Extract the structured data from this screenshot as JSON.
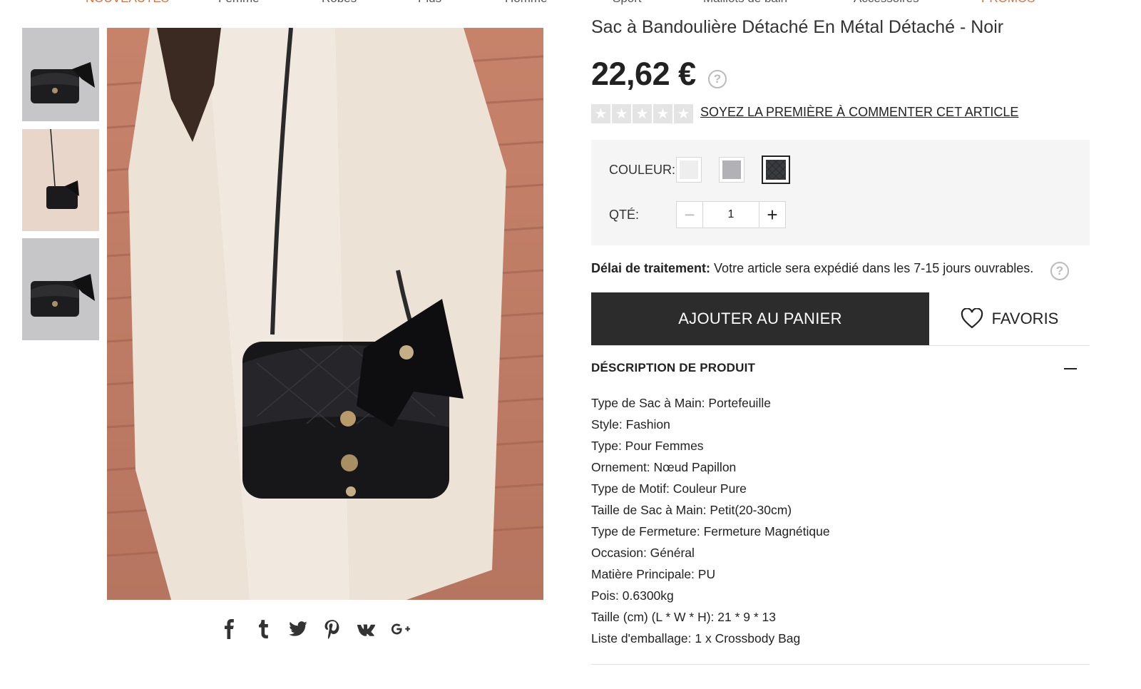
{
  "nav": {
    "items": [
      {
        "label": "NOUVEAUTÉS",
        "accent": true
      },
      {
        "label": "Femme",
        "accent": false
      },
      {
        "label": "Robes",
        "accent": false
      },
      {
        "label": "Plus",
        "accent": false
      },
      {
        "label": "Homme",
        "accent": false
      },
      {
        "label": "Sport",
        "accent": false
      },
      {
        "label": "Maillots de bain",
        "accent": false
      },
      {
        "label": "Accessoires",
        "accent": false
      },
      {
        "label": "PROMOS",
        "accent": true
      }
    ],
    "accent_color": "#d5703f"
  },
  "gallery": {
    "thumbnails": [
      "bag-product-photo",
      "model-wearing-bag-photo",
      "bag-product-photo"
    ],
    "selected_index": 1
  },
  "share": {
    "icons": [
      "facebook-icon",
      "tumblr-icon",
      "twitter-icon",
      "pinterest-icon",
      "vk-icon",
      "google-plus-icon"
    ]
  },
  "product": {
    "title": "Sac à Bandoulière Détaché En Métal Détaché - Noir",
    "price": "22,62 €",
    "rating_stars": 0,
    "review_link": "SOYEZ LA PREMIÈRE À COMMENTER CET ARTICLE"
  },
  "options": {
    "color_label": "COULEUR:",
    "colors": [
      {
        "name": "white",
        "hex": "#eeeeee"
      },
      {
        "name": "grey",
        "hex": "#b2b2b6"
      },
      {
        "name": "black",
        "hex": "#3a3b3e"
      }
    ],
    "selected_color": 2,
    "qty_label": "QTÉ:",
    "qty_value": "1"
  },
  "shipping": {
    "label": "Délai de traitement:",
    "text": " Votre article sera expédié dans les 7-15 jours ouvrables."
  },
  "actions": {
    "add_to_cart": "AJOUTER AU PANIER",
    "favorites": "FAVORIS",
    "button_color": "#2c2c2c"
  },
  "description": {
    "heading": "DÉSCRIPTION DE PRODUIT",
    "specs": [
      "Type de Sac à Main: Portefeuille",
      "Style: Fashion",
      "Type: Pour Femmes",
      "Ornement: Nœud Papillon",
      "Type de Motif: Couleur Pure",
      "Taille de Sac à Main: Petit(20-30cm)",
      "Type de Fermeture: Fermeture Magnétique",
      "Occasion: Général",
      "Matière Principale: PU",
      "Pois: 0.6300kg",
      "Taille (cm) (L * W * H): 21 * 9 * 13",
      "Liste d'emballage: 1 x Crossbody Bag"
    ]
  }
}
